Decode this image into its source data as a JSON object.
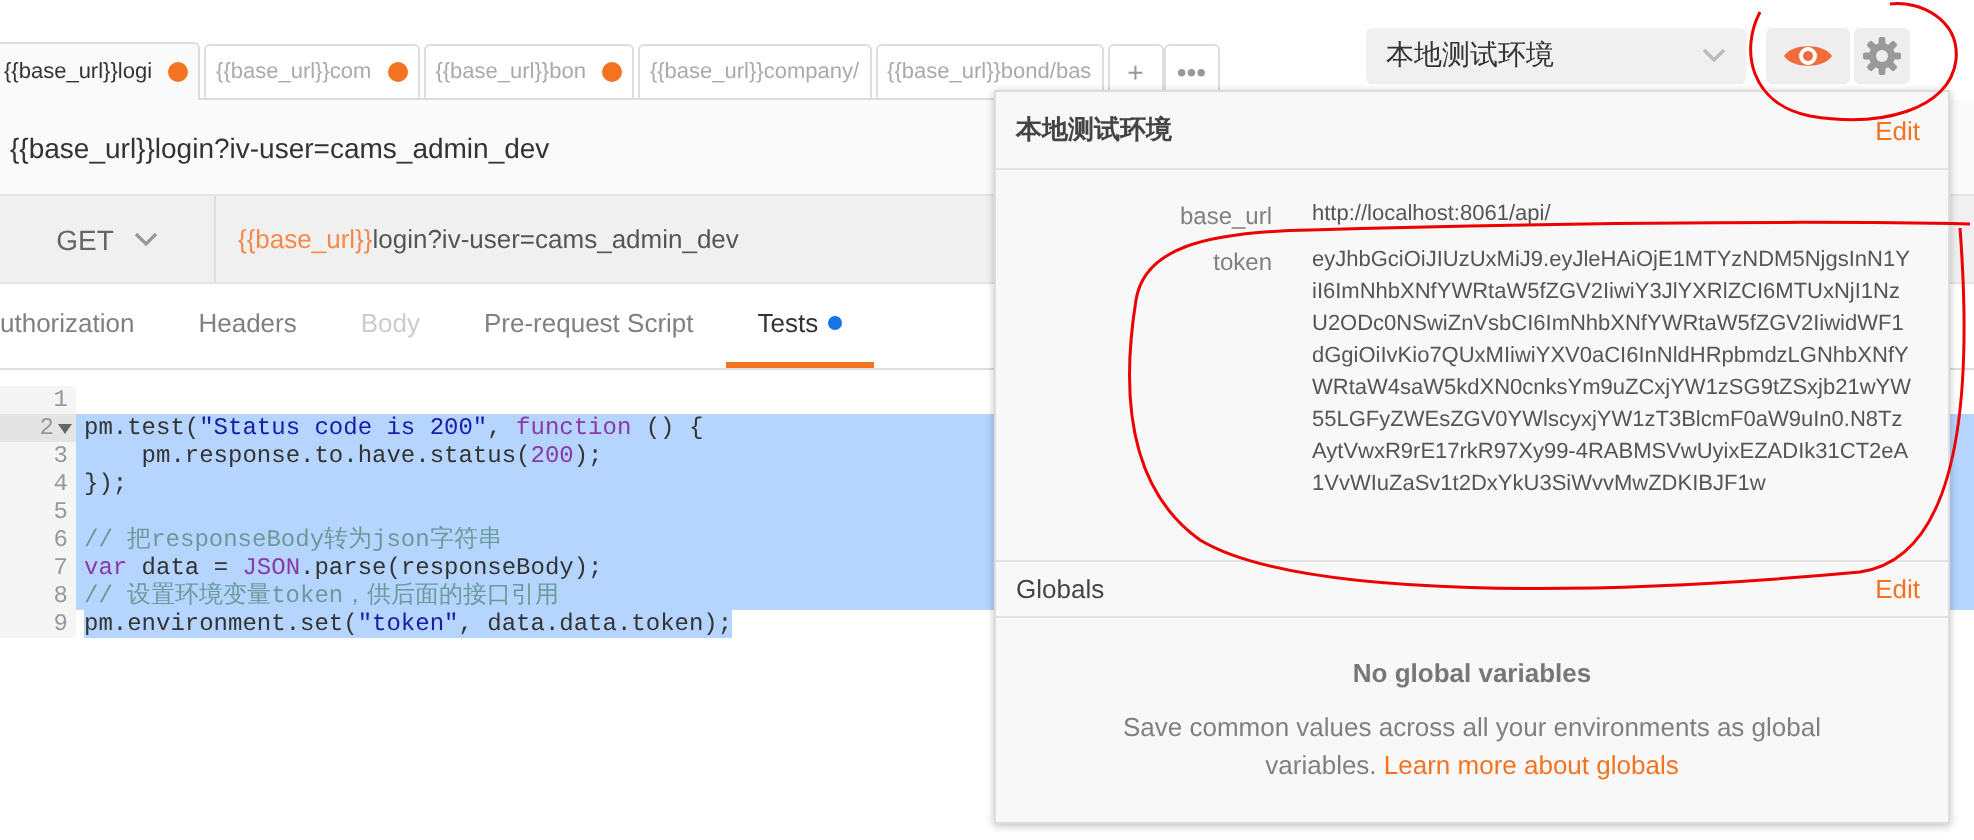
{
  "tabs": [
    {
      "label": "{{base_url}}logi",
      "dirty": true,
      "selected": true
    },
    {
      "label": "{{base_url}}com",
      "dirty": true,
      "selected": false
    },
    {
      "label": "{{base_url}}bon",
      "dirty": true,
      "selected": false
    },
    {
      "label": "{{base_url}}company/",
      "dirty": false,
      "selected": false
    },
    {
      "label": "{{base_url}}bond/bas",
      "dirty": false,
      "selected": false
    }
  ],
  "tab_actions": [
    "+",
    "•••"
  ],
  "environment": {
    "selected": "本地测试环境"
  },
  "request": {
    "title": "{{base_url}}login?iv-user=cams_admin_dev",
    "method": "GET",
    "url_variable": "{{base_url}}",
    "url_path": "login?iv-user=cams_admin_dev"
  },
  "subtabs": [
    {
      "label": "uthorization",
      "selected": false,
      "disabled": false,
      "dot": false
    },
    {
      "label": "Headers",
      "selected": false,
      "disabled": false,
      "dot": false
    },
    {
      "label": "Body",
      "selected": false,
      "disabled": true,
      "dot": false
    },
    {
      "label": "Pre-request Script",
      "selected": false,
      "disabled": false,
      "dot": false
    },
    {
      "label": "Tests",
      "selected": true,
      "disabled": false,
      "dot": true
    }
  ],
  "code": [
    {
      "number": "1",
      "selected": false,
      "fold": false
    },
    {
      "number": "2",
      "selected": true,
      "full_width": true,
      "fold": true,
      "tokens": [
        {
          "text": "pm.test(",
          "kind": "plain"
        },
        {
          "text": "\"Status code is 200\"",
          "kind": "string"
        },
        {
          "text": ", ",
          "kind": "plain"
        },
        {
          "text": "function",
          "kind": "keyword"
        },
        {
          "text": " () {",
          "kind": "plain"
        }
      ]
    },
    {
      "number": "3",
      "selected": true,
      "full_width": true,
      "fold": false,
      "tokens": [
        {
          "text": "    pm.response.to.have.status(",
          "kind": "plain"
        },
        {
          "text": "200",
          "kind": "number"
        },
        {
          "text": ");",
          "kind": "plain"
        }
      ]
    },
    {
      "number": "4",
      "selected": true,
      "full_width": true,
      "fold": false,
      "tokens": [
        {
          "text": "});",
          "kind": "plain"
        }
      ]
    },
    {
      "number": "5",
      "selected": true,
      "full_width": true,
      "fold": false
    },
    {
      "number": "6",
      "selected": true,
      "full_width": true,
      "fold": false,
      "tokens": [
        {
          "text": "// 把responseBody转为json字符串",
          "kind": "comment"
        }
      ]
    },
    {
      "number": "7",
      "selected": true,
      "full_width": true,
      "fold": false,
      "tokens": [
        {
          "text": "var",
          "kind": "keyword"
        },
        {
          "text": " data = ",
          "kind": "plain"
        },
        {
          "text": "JSON",
          "kind": "keyword"
        },
        {
          "text": ".parse(responseBody);",
          "kind": "plain"
        }
      ]
    },
    {
      "number": "8",
      "selected": true,
      "full_width": true,
      "fold": false,
      "tokens": [
        {
          "text": "// 设置环境变量token，供后面的接口引用",
          "kind": "comment"
        }
      ]
    },
    {
      "number": "9",
      "selected": true,
      "full_width": false,
      "fold": false,
      "tokens": [
        {
          "text": "pm.environment.set(",
          "kind": "plain"
        },
        {
          "text": "\"token\"",
          "kind": "string"
        },
        {
          "text": ", data.data.token);",
          "kind": "plain"
        }
      ]
    }
  ],
  "popup": {
    "title": "本地测试环境",
    "edit": "Edit",
    "variables": [
      {
        "key": "base_url",
        "value": "http://localhost:8061/api/"
      },
      {
        "key": "token",
        "value": "eyJhbGciOiJIUzUxMiJ9.eyJleHAiOjE1MTYzNDM5NjgsInN1YiI6ImNhbXNfYWRtaW5fZGV2IiwiY3JlYXRlZCI6MTUxNjI1NzU2ODc0NSwiZnVsbCI6ImNhbXNfYWRtaW5fZGV2IiwidWF1dGgiOiIvKio7QUxMIiwiYXV0aCI6InNldHRpbmdzLGNhbXNfYWRtaW4saW5kdXN0cnksYm9uZCxjYW1zSG9tZSxjb21wYW55LGFyZWEsZGV0YWlscyxjYW1zT3BlcmF0aW9uIn0.N8TzAytVwxR9rE17rkR97Xy99-4RABMSVwUyixEZADIk31CT2eA1VvWIuZaSv1t2DxYkU3SiWvvMwZDKIBJF1w"
      }
    ],
    "globals_title": "Globals",
    "globals_edit": "Edit",
    "globals_empty": "No global variables",
    "globals_text": "Save common values across all your environments as global variables.",
    "globals_link": "Learn more about globals"
  }
}
